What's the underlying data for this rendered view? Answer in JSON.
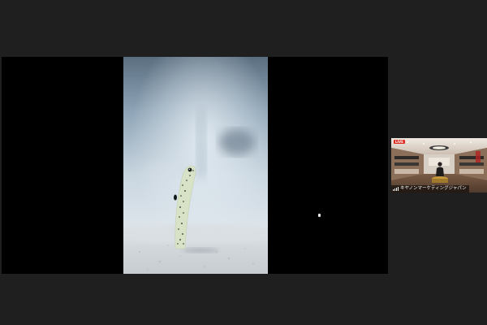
{
  "meeting": {
    "shared_screen": {
      "content": "spotted-garden-eel-photo"
    },
    "participant_tile": {
      "live_badge": "LIVE",
      "name": "キヤノンマーケティングジャパン",
      "signal_icon": "signal-bars-icon",
      "live_color": "#e02b20"
    }
  }
}
